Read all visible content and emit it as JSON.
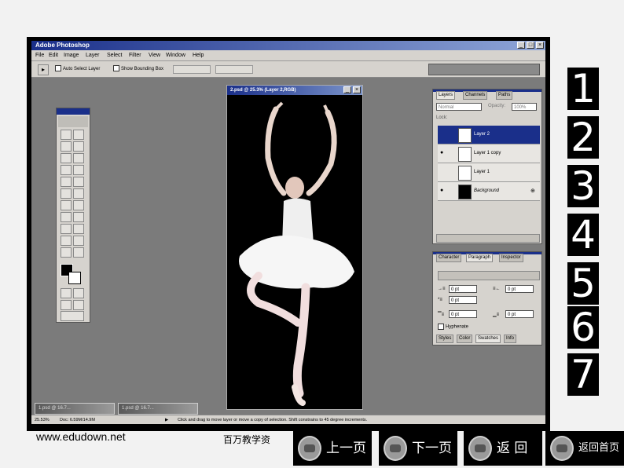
{
  "window": {
    "title": "Adobe Photoshop"
  },
  "menu": [
    "File",
    "Edit",
    "Image",
    "Layer",
    "Select",
    "Filter",
    "View",
    "Window",
    "Help"
  ],
  "options_bar": {
    "auto_select": "Auto Select Layer",
    "show_bounding": "Show Bounding Box"
  },
  "document": {
    "title": "2.psd @ 25.3% (Layer 2,RGB)"
  },
  "layers_panel": {
    "tabs": [
      "Layers",
      "Channels",
      "Paths"
    ],
    "blend_mode": "Normal",
    "opacity_label": "Opacity:",
    "opacity_value": "100%",
    "lock_label": "Lock:",
    "layers": [
      {
        "name": "Layer 2",
        "selected": true
      },
      {
        "name": "Layer 1 copy",
        "selected": false
      },
      {
        "name": "Layer 1",
        "selected": false
      },
      {
        "name": "Background",
        "selected": false
      }
    ]
  },
  "paragraph_panel": {
    "tabs": [
      "Character",
      "Paragraph",
      "Inspector"
    ],
    "fields": {
      "left_indent": "0 pt",
      "right_indent": "0 pt",
      "first_line": "0 pt",
      "space_before": "0 pt",
      "space_after": "0 pt"
    },
    "hyphenate": "Hyphenate",
    "bottom_tabs": [
      "Styles",
      "Color",
      "Swatches",
      "Info"
    ]
  },
  "minimized_windows": [
    "1.psd @ 16.7...",
    "1.psd @ 16.7..."
  ],
  "status_bar": {
    "zoom": "25.53%",
    "doc": "Doc: 6.59M/14.9M",
    "hint": "Click and drag to move layer or move a copy of selection. Shift constrains to 45 degree increments."
  },
  "slide_numbers": [
    "1",
    "2",
    "3",
    "4",
    "5",
    "6",
    "7"
  ],
  "footer": {
    "url": "www.edudown.net",
    "caption": "百万教学资"
  },
  "nav_buttons": [
    "上一页",
    "下一页",
    "返 回",
    "返回首页"
  ],
  "colors": {
    "titlebar": "#1a2f8a",
    "workspace": "#7b7b7b",
    "panel": "#d6d3ce"
  }
}
